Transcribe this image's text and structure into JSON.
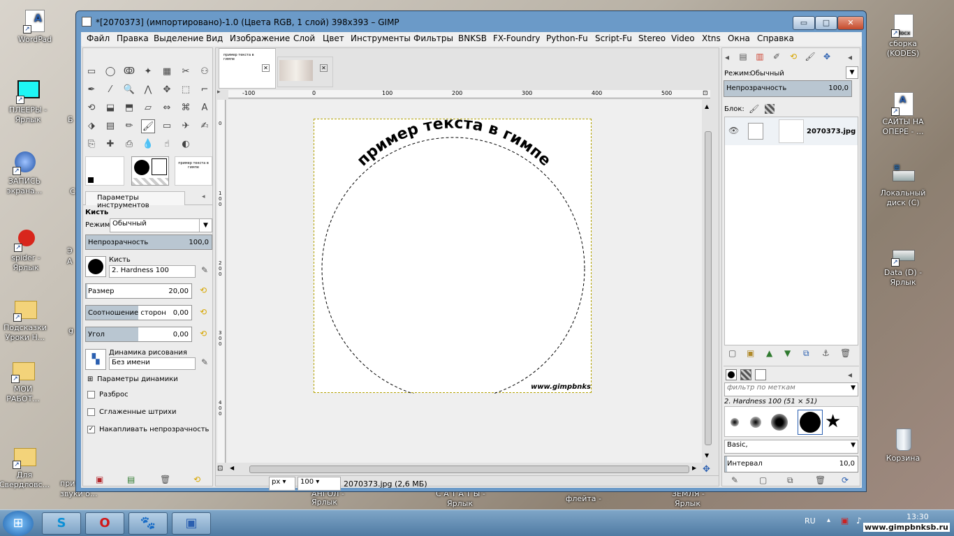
{
  "desktop": {
    "icons_left": [
      {
        "label": "WordPad",
        "icon": "wordpad-icon"
      },
      {
        "label": "ПЛЕЕРЫ -\nЯрлык",
        "icon": "monitor-icon"
      },
      {
        "label": "ЗАПИСЬ\nэкрана...",
        "icon": "recording-icon"
      },
      {
        "label": "spider -\nЯрлык",
        "icon": "spider-icon"
      },
      {
        "label": "Подсказки\nУроки Н...",
        "icon": "folder-icon"
      },
      {
        "label": "МОИ\nРАБОТ...",
        "icon": "folder-icon"
      },
      {
        "label": "Для\nСвердловс...",
        "icon": "folder-icon"
      }
    ],
    "icons_right": [
      {
        "label": "сборка\n(KODES)",
        "icon": "docx-icon"
      },
      {
        "label": "САЙТЫ НА\nОПЕРЕ - ...",
        "icon": "document-icon"
      },
      {
        "label": "Локальный\nдиск (C)",
        "icon": "drive-icon"
      },
      {
        "label": "Data (D) -\nЯрлык",
        "icon": "drive-icon"
      },
      {
        "label": "Корзина",
        "icon": "recycle-bin-icon"
      }
    ],
    "partial_labels": {
      "b1": "Б",
      "b2": "С",
      "b3": "Э",
      "b4": "A",
      "b5": "g",
      "pri": "при",
      "zvuki": "звуки о...",
      "bottom1": "Ярлык",
      "bottom1b": "АНГОЛ -",
      "bottom2": "С А Т А Т Ы -",
      "bottom2b": "Ярлык",
      "bottom3": "флейта -",
      "bottom4": "ЗЕМЛЯ -",
      "bottom4b": "Ярлык"
    }
  },
  "window": {
    "title": "*[2070373] (импортировано)-1.0 (Цвета RGB, 1 слой) 398x393 – GIMP",
    "minimize": "▭",
    "maximize": "□",
    "close": "✕"
  },
  "menu": [
    "Файл",
    "Правка",
    "Выделение",
    "Вид",
    "Изображение",
    "Слой",
    "Цвет",
    "Инструменты",
    "Фильтры",
    "BNKSB",
    "FX-Foundry",
    "Python-Fu",
    "Script-Fu",
    "Stereo",
    "Video",
    "Xtns",
    "Окна",
    "Справка"
  ],
  "toolbox": {
    "tools": [
      "rect-select-icon",
      "ellipse-select-icon",
      "free-select-icon",
      "fuzzy-select-icon",
      "color-select-icon",
      "scissors-icon",
      "foreground-select-icon",
      "paths-icon",
      "color-picker-icon",
      "zoom-icon",
      "measure-icon",
      "move-icon",
      "align-icon",
      "crop-icon",
      "rotate-icon",
      "scale-icon",
      "shear-icon",
      "perspective-icon",
      "flip-icon",
      "cage-icon",
      "text-icon",
      "bucket-fill-icon",
      "blend-icon",
      "pencil-icon",
      "paintbrush-icon",
      "eraser-icon",
      "airbrush-icon",
      "ink-icon",
      "clone-icon",
      "heal-icon",
      "perspective-clone-icon",
      "blur-icon",
      "smudge-icon",
      "dodge-icon"
    ],
    "tools_glyphs": [
      "▭",
      "◯",
      "ↂ",
      "✦",
      "▦",
      "✂",
      "⚇",
      "✒",
      "⁄",
      "🔍",
      "⋀",
      "✥",
      "⬚",
      "⌐",
      "⟲",
      "⬓",
      "⬒",
      "▱",
      "⇔",
      "⌘",
      "A",
      "⬗",
      "▤",
      "✏",
      "🖌",
      "▭",
      "✈",
      "✍",
      "⎘",
      "✚",
      "⎙",
      "💧",
      "☝",
      "◐"
    ],
    "brush_preview_text": "пример текста в гимпе"
  },
  "tool_options": {
    "tab_label": "Параметры инструментов",
    "tool_name": "Кисть",
    "mode_label": "Режим:",
    "mode_value": "Обычный",
    "opacity_label": "Непрозрачность",
    "opacity_value": "100,0",
    "opacity_fraction": 1.0,
    "brush_label": "Кисть",
    "brush_value": "2. Hardness 100",
    "size_label": "Размер",
    "size_value": "20,00",
    "aspect_label": "Соотношение сторон",
    "aspect_value": "0,00",
    "angle_label": "Угол",
    "angle_value": "0,00",
    "dynamics_label": "Динамика рисования",
    "dynamics_value": "Без имени",
    "dynamics_options": "Параметры динамики",
    "jitter": "Разброс",
    "smooth": "Сглаженные штрихи",
    "incremental": "Накапливать непрозрачность",
    "incremental_checked": "✓"
  },
  "canvas": {
    "ruler_h": [
      "-100",
      "0",
      "100",
      "200",
      "300",
      "400",
      "500"
    ],
    "ruler_v": [
      "0",
      "1\n0\n0",
      "2\n0\n0",
      "3\n0\n0",
      "4\n0\n0"
    ],
    "arc_text": "пример текста в гимпе",
    "watermark": "www.gimpbnks",
    "unit": "px",
    "zoom": "100",
    "status": "2070373.jpg (2,6 МБ)"
  },
  "layers": {
    "mode_label": "Режим:",
    "mode_value": "Обычный",
    "opacity_label": "Непрозрачность",
    "opacity_value": "100,0",
    "lock_label": "Блок:",
    "layer_name": "2070373.jpg"
  },
  "brushes": {
    "filter_placeholder": "фильтр по меткам",
    "current": "2. Hardness 100 (51 × 51)",
    "set": "Basic,",
    "spacing_label": "Интервал",
    "spacing_value": "10,0"
  },
  "taskbar": {
    "lang": "RU",
    "time": "13:30",
    "watermark": "www.gimpbnksb.ru",
    "buttons": [
      "windows-start-icon",
      "skype-icon",
      "opera-icon",
      "gimp-icon",
      "picture-viewer-icon"
    ],
    "glyphs": [
      "⊞",
      "S",
      "O",
      "🐾",
      "▣"
    ]
  },
  "colors": {
    "accent": "#6b9ac8",
    "selection": "#b9c6d1",
    "taskbar": "#5e89b1"
  }
}
